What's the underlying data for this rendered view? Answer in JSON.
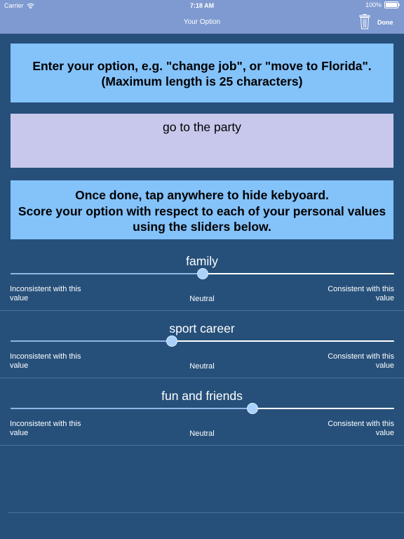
{
  "status_bar": {
    "carrier": "Carrier",
    "time": "7:18 AM",
    "battery": "100%"
  },
  "nav": {
    "title": "Your Option",
    "done_label": "Done"
  },
  "instruction": {
    "line1": "Enter your option, e.g. \"change job\", or \"move to Florida\".",
    "line2": "(Maximum length is 25 characters)"
  },
  "option": {
    "value": "go to the party"
  },
  "help": {
    "line1": "Once done, tap anywhere to hide kebyoard.",
    "line2": "Score your option with respect to each of your personal values",
    "line3": "using the sliders below."
  },
  "values": [
    {
      "name": "family",
      "level": 0.5,
      "left_label": "Inconsistent with this value",
      "mid_label": "Neutral",
      "right_label": "Consistent with this value"
    },
    {
      "name": "sport career",
      "level": 0.42,
      "left_label": "Inconsistent with this value",
      "mid_label": "Neutral",
      "right_label": "Consistent with this value"
    },
    {
      "name": "fun and friends",
      "level": 0.63,
      "left_label": "Inconsistent with this value",
      "mid_label": "Neutral",
      "right_label": "Consistent with this value"
    }
  ],
  "colors": {
    "background": "#26507a",
    "header": "#7f9ad0",
    "info_box": "#84c2fa",
    "input_box": "#c8c8ec",
    "slider_thumb": "#a8d2fa"
  }
}
